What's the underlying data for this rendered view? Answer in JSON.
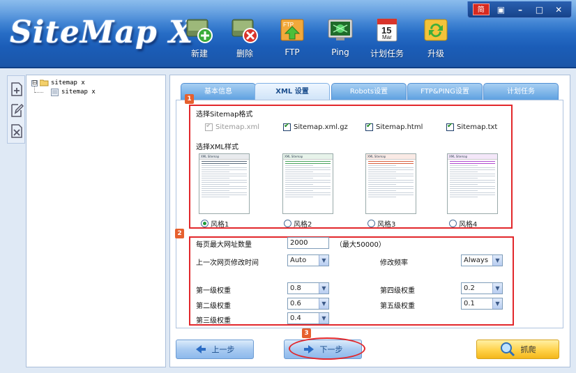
{
  "app": {
    "logo_text": "SiteMap X",
    "window_controls": {
      "lang": "简",
      "skin": "▣",
      "minimize": "–",
      "maximize": "□",
      "close": "✕"
    }
  },
  "toolbar": [
    {
      "label": "新建",
      "icon": "add-document-icon"
    },
    {
      "label": "删除",
      "icon": "delete-document-icon"
    },
    {
      "label": "FTP",
      "icon": "ftp-upload-icon"
    },
    {
      "label": "Ping",
      "icon": "ping-icon"
    },
    {
      "label": "计划任务",
      "icon": "calendar-icon",
      "calendar_day": "15",
      "calendar_month": "Mar"
    },
    {
      "label": "升级",
      "icon": "update-icon"
    }
  ],
  "left_strip": [
    "add-project-icon",
    "edit-project-icon",
    "remove-project-icon"
  ],
  "tree": {
    "root": {
      "label": "sitemap x",
      "expander": "⊟"
    },
    "child": {
      "label": "sitemap x"
    }
  },
  "tabs": [
    {
      "label": "基本信息",
      "active": false
    },
    {
      "label": "XML 设置",
      "active": true
    },
    {
      "label": "Robots设置",
      "active": false
    },
    {
      "label": "FTP&PING设置",
      "active": false
    },
    {
      "label": "计划任务",
      "active": false
    }
  ],
  "section1": {
    "badge": "1",
    "format_title": "选择Sitemap格式",
    "formats": [
      {
        "label": "Sitemap.xml",
        "checked": true,
        "disabled": true
      },
      {
        "label": "Sitemap.xml.gz",
        "checked": true,
        "disabled": false
      },
      {
        "label": "Sitemap.html",
        "checked": true,
        "disabled": false
      },
      {
        "label": "Sitemap.txt",
        "checked": true,
        "disabled": false
      }
    ],
    "style_title": "选择XML样式",
    "styles": [
      {
        "label": "风格1",
        "selected": true,
        "thumb_title": "XML Sitemap",
        "accent": "#5b6c7d"
      },
      {
        "label": "风格2",
        "selected": false,
        "thumb_title": "XML Sitemap",
        "accent": "#4aa35e"
      },
      {
        "label": "风格3",
        "selected": false,
        "thumb_title": "XML Sitemap",
        "accent": "#d9603f"
      },
      {
        "label": "风格4",
        "selected": false,
        "thumb_title": "XML Sitemap",
        "accent": "#b04ad0"
      }
    ]
  },
  "section2": {
    "badge": "2",
    "max_urls_label": "每页最大网址数量",
    "max_urls_value": "2000",
    "max_urls_hint": "（最大50000）",
    "lastmod_label": "上一次网页修改时间",
    "lastmod_value": "Auto",
    "changefreq_label": "修改频率",
    "changefreq_value": "Always",
    "p1_label": "第一级权重",
    "p1_value": "0.8",
    "p2_label": "第二级权重",
    "p2_value": "0.6",
    "p3_label": "第三级权重",
    "p3_value": "0.4",
    "p4_label": "第四级权重",
    "p4_value": "0.2",
    "p5_label": "第五级权重",
    "p5_value": "0.1"
  },
  "buttons": {
    "prev": "上一步",
    "next": "下一步",
    "crawl": "抓爬",
    "next_badge": "3"
  },
  "colors": {
    "highlight_red": "#e2272b",
    "badge_orange": "#e6602e",
    "header_blue": "#2f78cf"
  }
}
